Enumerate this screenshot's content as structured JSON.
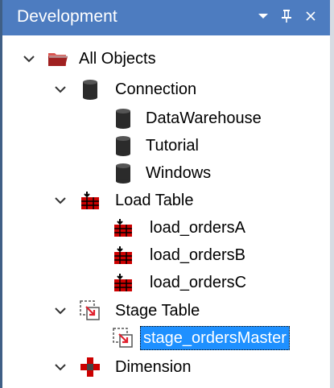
{
  "panel": {
    "title": "Development"
  },
  "tree": {
    "root": {
      "label": "All Objects",
      "icon": "folder-icon"
    },
    "connection": {
      "label": "Connection",
      "icon": "database-icon",
      "children": [
        "DataWarehouse",
        "Tutorial",
        "Windows"
      ]
    },
    "load_table": {
      "label": "Load Table",
      "icon": "load-table-icon",
      "children": [
        "load_ordersA",
        "load_ordersB",
        "load_ordersC"
      ]
    },
    "stage_table": {
      "label": "Stage Table",
      "icon": "stage-table-icon",
      "children": [
        "stage_ordersMaster"
      ],
      "selected": "stage_ordersMaster"
    },
    "dimension": {
      "label": "Dimension",
      "icon": "dimension-icon"
    }
  },
  "colors": {
    "titlebar": "#4d7cc0",
    "selection": "#1e90ff",
    "load_icon": "#cc0000"
  }
}
